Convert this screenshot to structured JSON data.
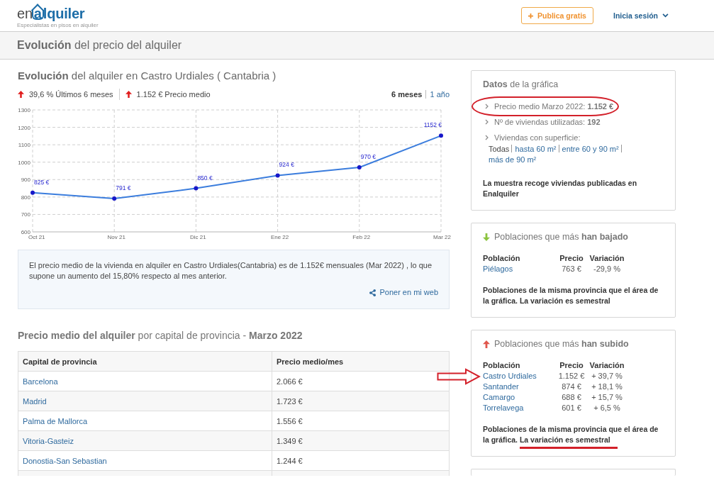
{
  "header": {
    "logo": {
      "before": "en",
      "framed": "a",
      "after": "lquiler"
    },
    "tagline": "Especialistas en pisos en alquiler",
    "publish_button": "Publica gratis",
    "login": "Inicia sesión"
  },
  "page_title": "**Evolución** del precio del alquiler",
  "chart_section": {
    "title": "**Evolución** del alquiler en Castro Urdiales ( Cantabria )",
    "stats": [
      {
        "kind": "up",
        "text": "39,6 % Últimos 6 meses"
      },
      {
        "kind": "up",
        "text": "1.152 € Precio medio"
      }
    ],
    "periods": [
      {
        "label": "6 meses",
        "selected": true
      },
      {
        "label": "1 año",
        "selected": false
      }
    ],
    "chart_data": {
      "type": "line",
      "categories": [
        "Oct 21",
        "Nov 21",
        "Dic 21",
        "Ene 22",
        "Feb 22",
        "Mar 22"
      ],
      "values": [
        825,
        791,
        850,
        924,
        970,
        1152
      ],
      "value_labels": [
        "825 €",
        "791 €",
        "850 €",
        "924 €",
        "970 €",
        "1152 €"
      ],
      "ylim": [
        600,
        1300
      ],
      "yticks": [
        600,
        700,
        800,
        900,
        1000,
        1100,
        1200,
        1300
      ],
      "grid": true,
      "marker": true
    },
    "summary": "El precio medio de la vivienda en alquiler en Castro Urdiales(Cantabria) es de 1.152€ mensuales (Mar 2022) , lo que supone un aumento del 15,80% respecto al mes anterior.",
    "embed_link": "Poner en mi web"
  },
  "capitals_table": {
    "title": "**Precio medio del alquiler** por capital de provincia - **Marzo 2022**",
    "columns": [
      "Capital de provincia",
      "Precio medio/mes"
    ],
    "rows": [
      [
        "Barcelona",
        "2.066 €"
      ],
      [
        "Madrid",
        "1.723 €"
      ],
      [
        "Palma de Mallorca",
        "1.556 €"
      ],
      [
        "Vitoria-Gasteiz",
        "1.349 €"
      ],
      [
        "Donostia-San Sebastian",
        "1.244 €"
      ]
    ]
  },
  "sidebar": {
    "data_panel": {
      "title": "**Datos** de la gráfica",
      "items": [
        {
          "text": "Precio medio Marzo 2022: **1.152 €**",
          "circled": true
        },
        {
          "text": "Nº de viviendas utilizadas: **192**",
          "circled": false
        },
        {
          "text": "Viviendas con superficie:",
          "circled": false
        }
      ],
      "filters": [
        {
          "label": "Todas",
          "selected": true
        },
        {
          "label": "hasta 60 m²",
          "selected": false
        },
        {
          "label": "entre 60 y 90 m²",
          "selected": false
        },
        {
          "label": "más de 90 m²",
          "selected": false
        }
      ],
      "note": "La muestra recoge viviendas publicadas en Enalquiler"
    },
    "town_panels": [
      {
        "kind": "down",
        "title": "Poblaciones que más **han bajado**",
        "columns": [
          "Población",
          "Precio",
          "Variación"
        ],
        "rows": [
          {
            "town": "Piélagos",
            "price": "763 €",
            "variation": "-29,9 %",
            "pointed": false
          }
        ],
        "note": [
          {
            "text": "Poblaciones de la misma provincia que el área de la gráfica.",
            "underlined": false
          },
          {
            "text": "La variación es semestral",
            "underlined": false
          }
        ]
      },
      {
        "kind": "up",
        "title": "Poblaciones que más **han subido**",
        "columns": [
          "Población",
          "Precio",
          "Variación"
        ],
        "rows": [
          {
            "town": "Castro Urdiales",
            "price": "1.152 €",
            "variation": "+ 39,7 %",
            "pointed": true
          },
          {
            "town": "Santander",
            "price": "874 €",
            "variation": "+ 18,1 %",
            "pointed": false
          },
          {
            "town": "Camargo",
            "price": "688 €",
            "variation": "+ 15,7 %",
            "pointed": false
          },
          {
            "town": "Torrelavega",
            "price": "601 €",
            "variation": "+ 6,5 %",
            "pointed": false
          }
        ],
        "note": [
          {
            "text": "Poblaciones de la misma provincia que el área de la gráfica.",
            "underlined": false
          },
          {
            "text": "La variación es semestral",
            "underlined": true
          }
        ]
      }
    ]
  }
}
